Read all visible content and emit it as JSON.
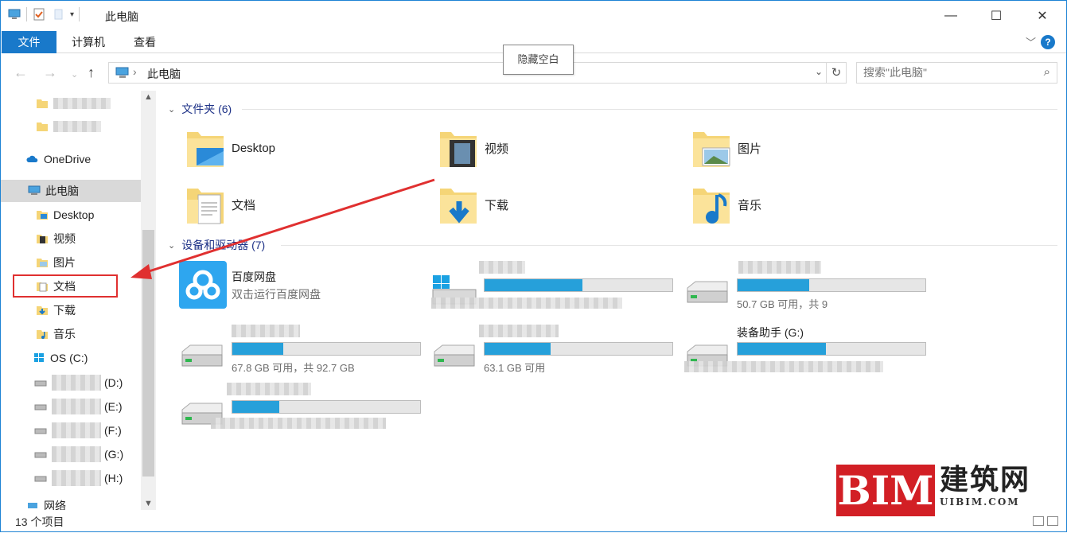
{
  "window": {
    "title": "此电脑",
    "minimize": "—",
    "maximize": "☐",
    "close": "✕"
  },
  "ribbon": {
    "tabs": [
      "文件",
      "计算机",
      "查看"
    ],
    "help": "?"
  },
  "tooltip": "隐藏空白",
  "address": {
    "location": "此电脑",
    "search_placeholder": "搜索\"此电脑\""
  },
  "nav": {
    "onedrive": "OneDrive",
    "this_pc": "此电脑",
    "items": [
      "Desktop",
      "视频",
      "图片",
      "文档",
      "下载",
      "音乐",
      "OS (C:)"
    ],
    "partial_drives": [
      "(D:)",
      "(E:)",
      "(F:)",
      "(G:)",
      "(H:)"
    ],
    "network": "网络"
  },
  "content": {
    "folders_header": "文件夹 (6)",
    "folders": [
      {
        "name": "Desktop",
        "icon": "desktop-folder-icon"
      },
      {
        "name": "视频",
        "icon": "videos-folder-icon"
      },
      {
        "name": "图片",
        "icon": "pictures-folder-icon"
      },
      {
        "name": "文档",
        "icon": "documents-folder-icon"
      },
      {
        "name": "下载",
        "icon": "downloads-folder-icon"
      },
      {
        "name": "音乐",
        "icon": "music-folder-icon"
      }
    ],
    "devices_header": "设备和驱动器 (7)",
    "baidu": {
      "name": "百度网盘",
      "desc": "双击运行百度网盘"
    },
    "drives": [
      {
        "name": "",
        "info": "",
        "usage": 0.52,
        "icon": "windows-drive-icon"
      },
      {
        "name": "",
        "info": "50.7 GB 可用，共 9",
        "usage": 0.38,
        "icon": "hard-drive-icon"
      },
      {
        "name": "",
        "info": "67.8 GB 可用，共 92.7 GB",
        "usage": 0.27,
        "icon": "hard-drive-icon"
      },
      {
        "name": "",
        "info": "63.1 GB 可用",
        "usage": 0.35,
        "icon": "hard-drive-icon"
      },
      {
        "name": "装备助手 (G:)",
        "info": "",
        "usage": 0.47,
        "icon": "hard-drive-icon"
      },
      {
        "name": "",
        "info": "",
        "usage": 0.25,
        "icon": "hard-drive-icon"
      }
    ]
  },
  "status": {
    "count": "13 个项目"
  },
  "watermark": {
    "brand": "BIM",
    "cn": "建筑网",
    "url": "UIBIM.COM"
  },
  "colors": {
    "accent": "#1979ca",
    "progress": "#26a0da",
    "highlight": "#e03030"
  }
}
